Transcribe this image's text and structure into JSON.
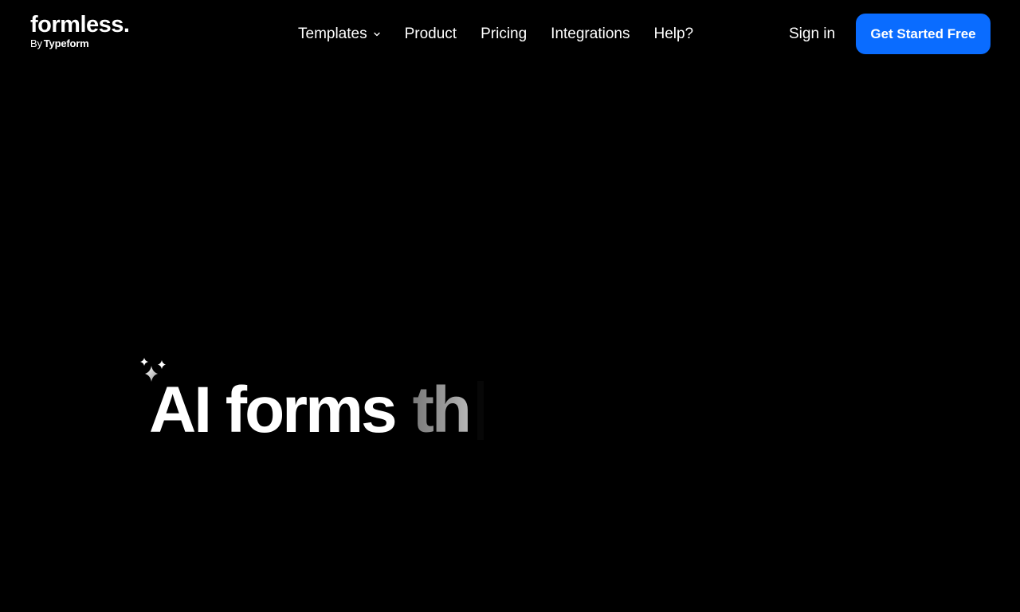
{
  "brand": {
    "name": "formless.",
    "by_prefix": "By",
    "by_brand": "Typeform"
  },
  "nav": {
    "items": [
      {
        "label": "Templates",
        "has_dropdown": true,
        "icon": "chevron-down-icon"
      },
      {
        "label": "Product"
      },
      {
        "label": "Pricing"
      },
      {
        "label": "Integrations"
      },
      {
        "label": "Help?"
      }
    ],
    "sign_in": "Sign in",
    "cta": "Get Started Free"
  },
  "hero": {
    "icon": "sparkles-icon",
    "headline_static": "AI forms",
    "headline_typing": "th"
  },
  "colors": {
    "background": "#000000",
    "text": "#ffffff",
    "accent": "#0a6cff",
    "typing_text": "#8a8a8a"
  }
}
